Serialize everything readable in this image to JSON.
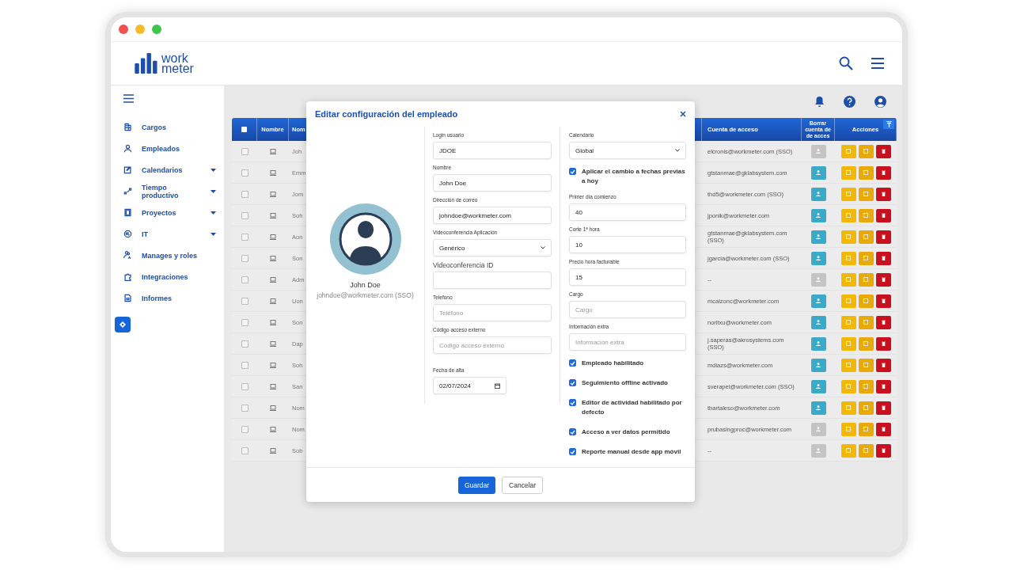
{
  "header": {
    "logo": {
      "line_1": "work",
      "line_2": "meter"
    }
  },
  "sidebar": {
    "items": [
      {
        "label": "Cargos",
        "expandable": false
      },
      {
        "label": "Empleados",
        "expandable": false
      },
      {
        "label": "Calendarios",
        "expandable": true
      },
      {
        "label": "Tiempo productivo",
        "expandable": true
      },
      {
        "label": "Proyectos",
        "expandable": true
      },
      {
        "label": "IT",
        "expandable": true
      },
      {
        "label": "Manages y roles",
        "expandable": false
      },
      {
        "label": "Integraciones",
        "expandable": false
      },
      {
        "label": "Informes",
        "expandable": false
      }
    ]
  },
  "table": {
    "select_all_checked": false,
    "columns": [
      "Nombre",
      "Nom",
      "Cuenta de acceso",
      "Borrar cuenta de de acces",
      "Acciones"
    ],
    "rows": [
      {
        "checked": false,
        "name": "Joh",
        "account": "elcronis@workmeter.com (SSO)",
        "delete_enabled": false
      },
      {
        "checked": false,
        "name": "Emm",
        "account": "gtstanmae@gklabsystem.com",
        "delete_enabled": true
      },
      {
        "checked": false,
        "name": "Jom",
        "account": "thd5@workmeter.com (SSO)",
        "delete_enabled": true
      },
      {
        "checked": false,
        "name": "Soh",
        "account": "jponik@workmeter.com",
        "delete_enabled": true
      },
      {
        "checked": false,
        "name": "Aon",
        "account": "gtstanmae@gklabsystem.com (SSO)",
        "delete_enabled": true
      },
      {
        "checked": false,
        "name": "Son",
        "account": "jgarcia@workmeter.com (SSO)",
        "delete_enabled": true
      },
      {
        "checked": false,
        "name": "Adm",
        "account": "--",
        "delete_enabled": false
      },
      {
        "checked": false,
        "name": "Uon",
        "account": "mcalzonc@workmeter.com",
        "delete_enabled": true
      },
      {
        "checked": false,
        "name": "Son",
        "account": "noritxu@workmeter.com",
        "delete_enabled": true
      },
      {
        "checked": false,
        "name": "Dap",
        "account": "j.saperas@akrosystems.com (SSO)",
        "delete_enabled": true
      },
      {
        "checked": false,
        "name": "Soh",
        "account": "mdiazs@workmeter.com",
        "delete_enabled": true
      },
      {
        "checked": false,
        "name": "San",
        "account": "sverapel@workmeter.com (SSO)",
        "delete_enabled": true
      },
      {
        "checked": false,
        "name": "Nom",
        "account": "tbartaleso@workmeter.com",
        "delete_enabled": true
      },
      {
        "checked": false,
        "name": "Nom",
        "account": "prubasingproc@workmeter.com",
        "delete_enabled": false
      },
      {
        "checked": false,
        "name": "Sob",
        "account": "--",
        "delete_enabled": false
      }
    ]
  },
  "modal": {
    "title": "Editar configuración del empleado",
    "profile": {
      "name": "John Doe",
      "email": "johndoe@workmeter.com (SSO)"
    },
    "left_fields": [
      {
        "kind": "input",
        "label": "Login usuario",
        "value": "JDOE"
      },
      {
        "kind": "input",
        "label": "Nombre",
        "value": "John Doe"
      },
      {
        "kind": "input",
        "label": "Dirección de correo",
        "value": "johndoe@workmeter.com"
      },
      {
        "kind": "select",
        "label": "Videoconferencia Aplicación",
        "value": "Genérico"
      },
      {
        "kind": "input",
        "label": "Videoconferencia ID",
        "large_label": true
      },
      {
        "kind": "input",
        "label": "Telefono",
        "placeholder": "Teléfono"
      },
      {
        "kind": "input",
        "label": "Código acceso externo",
        "placeholder": "Código acceso externo"
      },
      {
        "kind": "date",
        "label": "Fecha de alta",
        "value": "02/07/2024"
      }
    ],
    "right_fields": [
      {
        "kind": "select",
        "label": "Calendario",
        "value": "Global"
      },
      {
        "kind": "checkbox",
        "label": "Aplicar el cambio a fechas previas a hoy",
        "checked": true
      },
      {
        "kind": "input",
        "label": "Primer día comienzo",
        "value": "40"
      },
      {
        "kind": "input",
        "label": "Corte 1ª hora",
        "value": "10"
      },
      {
        "kind": "input",
        "label": "Precio hora facturable",
        "value": "15"
      },
      {
        "kind": "input",
        "label": "Cargo",
        "placeholder": "Cargo"
      },
      {
        "kind": "input",
        "label": "Información extra",
        "placeholder": "Información extra"
      },
      {
        "kind": "checkbox",
        "label": "Empleado habilitado",
        "checked": true
      },
      {
        "kind": "checkbox",
        "label": "Seguimiento offline activado",
        "checked": true
      },
      {
        "kind": "checkbox",
        "label": "Editor de actividad habilitado por defecto",
        "checked": true
      },
      {
        "kind": "checkbox",
        "label": "Acceso a ver datos permitido",
        "checked": true
      },
      {
        "kind": "checkbox",
        "label": "Reporte manual desde app móvil",
        "checked": true
      }
    ],
    "buttons": [
      {
        "label": "Guardar",
        "primary": true
      },
      {
        "label": "Cancelar",
        "primary": false
      }
    ]
  }
}
